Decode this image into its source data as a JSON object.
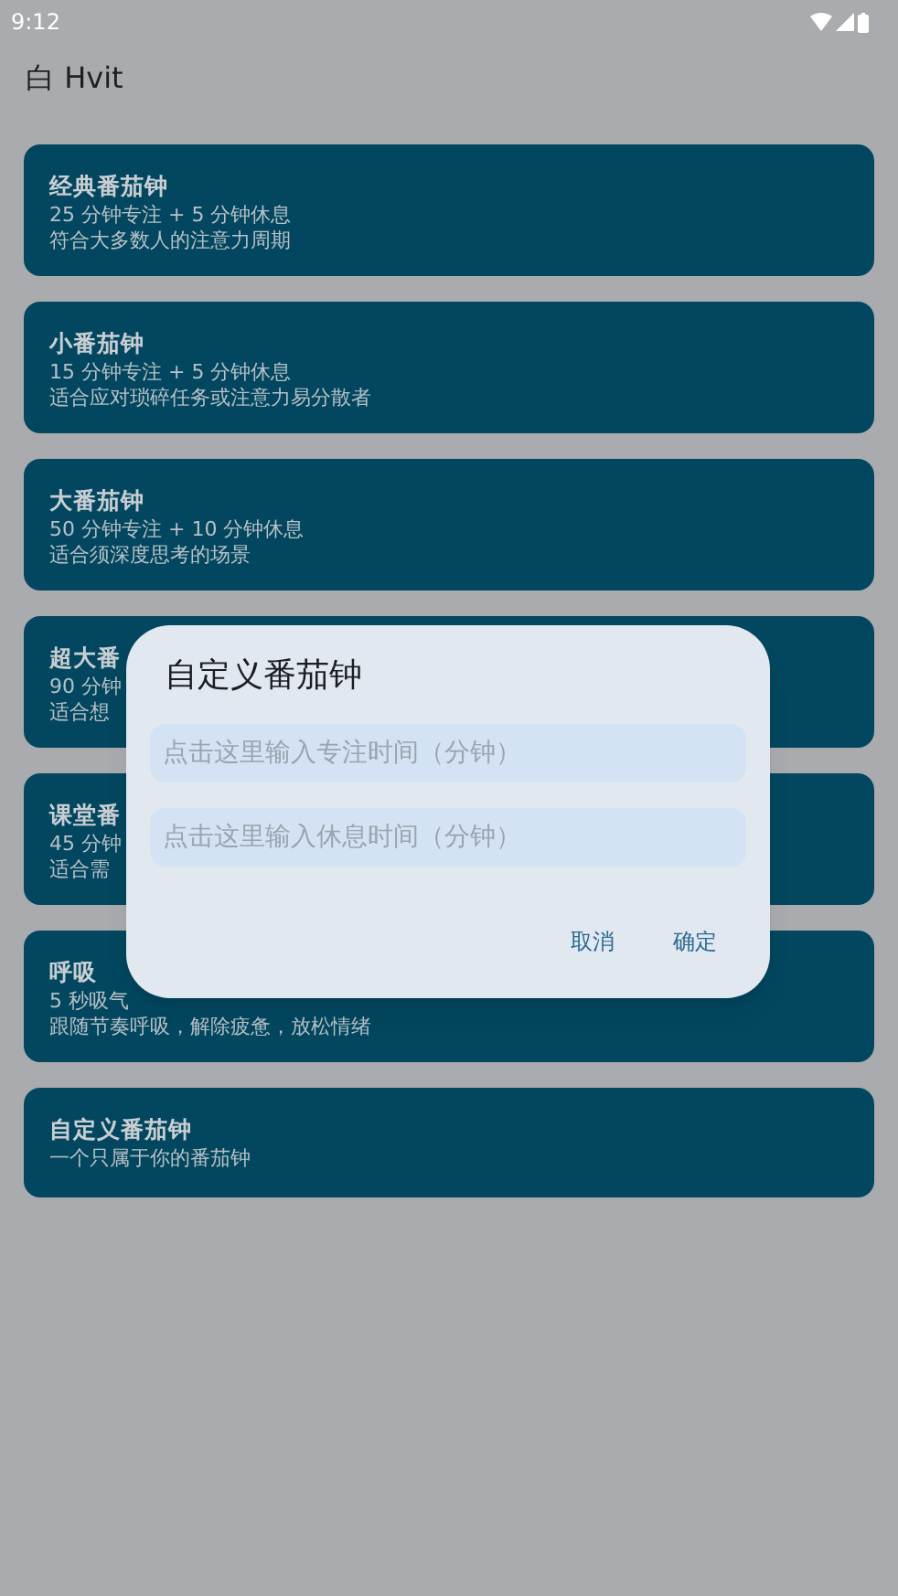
{
  "status_bar": {
    "time": "9:12"
  },
  "app_bar": {
    "title": "白 Hvit"
  },
  "cards": [
    {
      "title": "经典番茄钟",
      "lines": [
        "25 分钟专注 + 5 分钟休息",
        "符合大多数人的注意力周期"
      ]
    },
    {
      "title": "小番茄钟",
      "lines": [
        "15 分钟专注 + 5 分钟休息",
        "适合应对琐碎任务或注意力易分散者"
      ]
    },
    {
      "title": "大番茄钟",
      "lines": [
        "50 分钟专注 + 10 分钟休息",
        "适合须深度思考的场景"
      ]
    },
    {
      "title": "超大番",
      "lines": [
        "90 分钟",
        "适合想"
      ]
    },
    {
      "title": "课堂番",
      "lines": [
        "45 分钟",
        "适合需"
      ]
    },
    {
      "title": "呼吸",
      "lines": [
        "5 秒吸气",
        "跟随节奏呼吸，解除疲惫，放松情绪"
      ]
    },
    {
      "title": "自定义番茄钟",
      "lines": [
        "一个只属于你的番茄钟"
      ]
    }
  ],
  "dialog": {
    "title": "自定义番茄钟",
    "fields": [
      {
        "placeholder": "点击这里输入专注时间（分钟）"
      },
      {
        "placeholder": "点击这里输入休息时间（分钟）"
      }
    ],
    "buttons": [
      "取消",
      "确定"
    ]
  }
}
